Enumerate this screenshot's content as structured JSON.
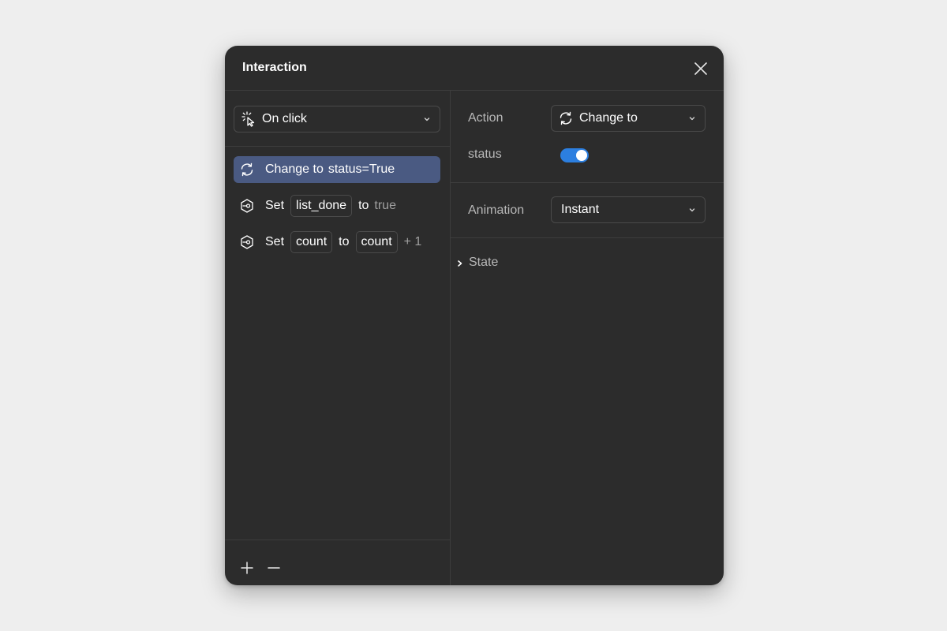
{
  "dialog": {
    "title": "Interaction"
  },
  "left": {
    "trigger": {
      "label": "On click",
      "icon": "tap-sparkle-icon"
    },
    "actions": [
      {
        "icon": "refresh-icon",
        "verb": "Change to",
        "target": "status=True",
        "selected": true
      },
      {
        "icon": "variable-set-icon",
        "verb": "Set",
        "variable": "list_done",
        "to": "to",
        "value": "true"
      },
      {
        "icon": "variable-set-icon",
        "verb": "Set",
        "variable": "count",
        "to": "to",
        "value_chip": "count",
        "suffix": "+ 1"
      }
    ],
    "footer": {
      "add_icon": "plus-icon",
      "remove_icon": "minus-icon"
    }
  },
  "right": {
    "action_label": "Action",
    "action_value": "Change to",
    "status_label": "status",
    "status_on": true,
    "animation_label": "Animation",
    "animation_value": "Instant",
    "state_label": "State"
  },
  "colors": {
    "accent": "#2c7fe0",
    "selected_row": "#4a5a82",
    "panel": "#2c2c2c",
    "background": "#eeeeee"
  }
}
